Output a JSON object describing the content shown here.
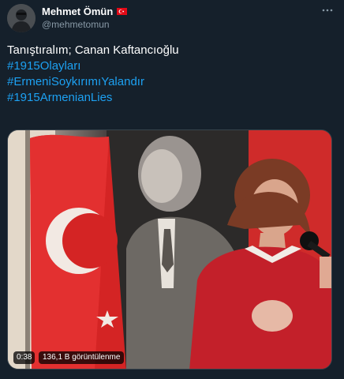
{
  "user": {
    "display_name": "Mehmet Ömün",
    "handle": "@mehmetomun",
    "flag_icon": "turkey-flag-icon",
    "avatar_icon": "avatar"
  },
  "menu": {
    "icon": "more-options-icon"
  },
  "tweet": {
    "text": "Tanıştıralım; Canan Kaftancıoğlu",
    "hashtags": [
      "#1915Olayları",
      "#ErmeniSoykırımıYalandır",
      "#1915ArmenianLies"
    ]
  },
  "video": {
    "duration": "0:38",
    "views": "136,1 B görüntülenme"
  },
  "colors": {
    "background": "#15202b",
    "hashtag": "#1da1f2",
    "secondary_text": "#8899a6",
    "flag_red": "#e30a17"
  }
}
